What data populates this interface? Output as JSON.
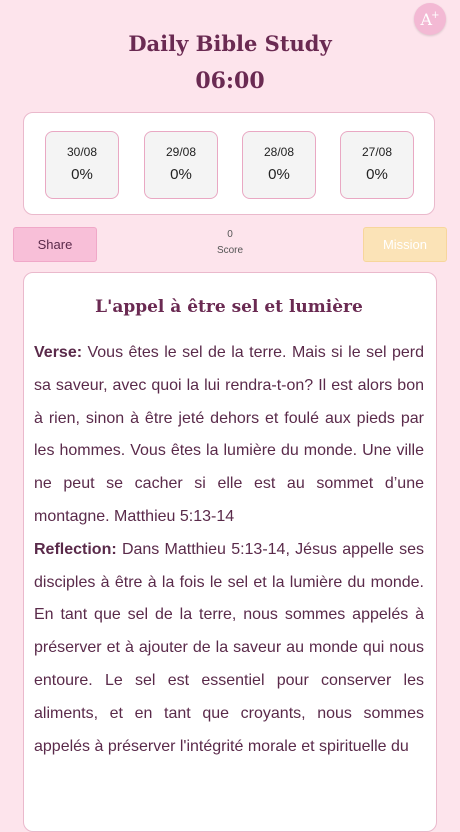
{
  "font_button": {
    "icon": "font-size-icon",
    "glyph": "A",
    "sup": "+"
  },
  "header": {
    "title": "Daily Bible Study",
    "timer": "06:00"
  },
  "days": [
    {
      "date": "30/08",
      "progress": "0%"
    },
    {
      "date": "29/08",
      "progress": "0%"
    },
    {
      "date": "28/08",
      "progress": "0%"
    },
    {
      "date": "27/08",
      "progress": "0%"
    }
  ],
  "actions": {
    "share_label": "Share",
    "score_value": "0",
    "score_label": "Score",
    "mission_label": "Mission"
  },
  "study": {
    "title": "L'appel à être sel et lumière",
    "verse_label": "Verse:",
    "verse_text": " Vous êtes le sel de la terre. Mais si le sel perd sa saveur, avec quoi la lui rendra-t-on? Il est alors bon à rien, sinon à être jeté dehors et foulé aux pieds par les hommes. Vous êtes la lumière du monde. Une ville ne peut se cacher si elle est au sommet d’une montagne. Matthieu 5:13-14",
    "reflection_label": "Reflection:",
    "reflection_text": " Dans Matthieu 5:13-14, Jésus appelle ses disciples à être à la fois le sel et la lumière du monde. En tant que sel de la terre, nous sommes appelés à préserver et à ajouter de la saveur au monde qui nous entoure. Le sel est essentiel pour conserver les aliments, et en tant que croyants, nous sommes appelés à préserver l'intégrité morale et spirituelle du"
  },
  "colors": {
    "background": "#fde4ec",
    "accent_pink": "#f8bfd8",
    "mission_yellow": "#fbe3b7",
    "title_purple": "#6a2a52"
  }
}
